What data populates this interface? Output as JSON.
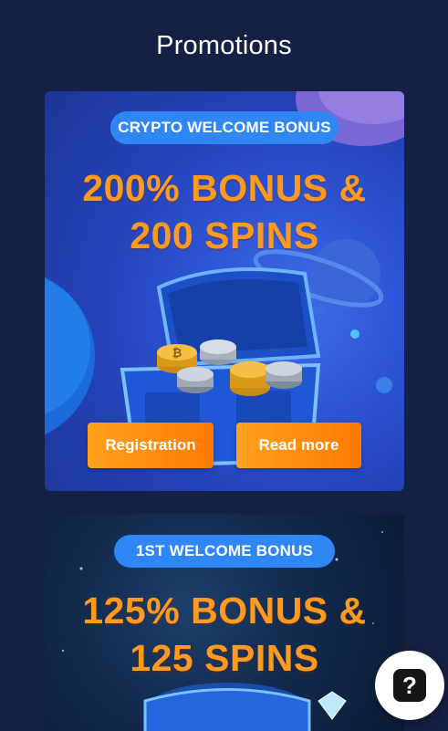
{
  "header": {
    "title": "Promotions"
  },
  "promotions": [
    {
      "badge": "CRYPTO WELCOME BONUS",
      "headline_line1": "200% BONUS &",
      "headline_line2": "200 SPINS",
      "primary_button": "Registration",
      "secondary_button": "Read more"
    },
    {
      "badge": "1ST WELCOME BONUS",
      "headline_line1": "125% BONUS &",
      "headline_line2": "125 SPINS"
    }
  ],
  "help": {
    "icon": "question-icon",
    "glyph": "?"
  },
  "colors": {
    "page_bg": "#142044",
    "badge_bg": "#2f86f5",
    "headline": "#ff9a1f",
    "button_from": "#ffa11d",
    "button_to": "#ff7a00"
  }
}
